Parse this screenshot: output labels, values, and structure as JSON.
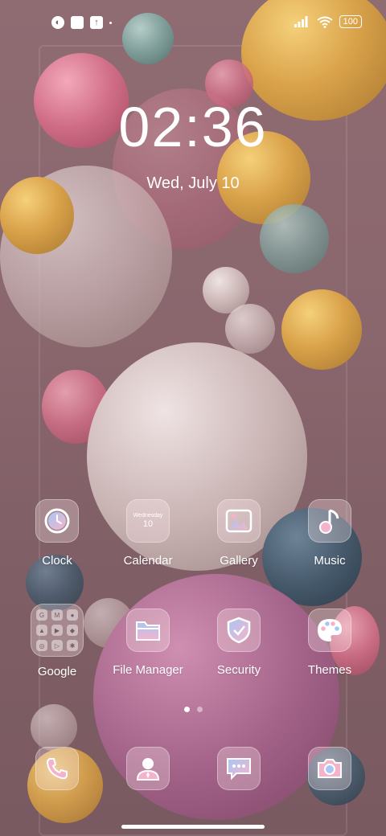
{
  "status_bar": {
    "left_icons": [
      "app-notification-icon",
      "square-notification-icon",
      "upload-icon",
      "dot-icon"
    ],
    "right_icons": [
      "signal-icon",
      "wifi-icon",
      "battery-icon"
    ],
    "battery": "100"
  },
  "lock": {
    "time": "02:36",
    "date": "Wed, July 10"
  },
  "apps": {
    "clock": "Clock",
    "calendar": "Calendar",
    "calendar_day": "Wednesday",
    "calendar_num": "10",
    "gallery": "Gallery",
    "music": "Music",
    "google": "Google",
    "file_manager": "File Manager",
    "security": "Security",
    "themes": "Themes"
  },
  "dock": [
    "phone-icon",
    "contacts-icon",
    "messages-icon",
    "camera-icon"
  ],
  "pager": {
    "pages": 2,
    "active": 1
  }
}
